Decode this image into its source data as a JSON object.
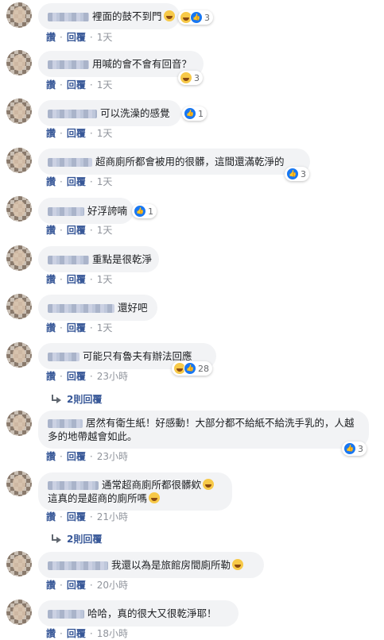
{
  "actions": {
    "like_label": "讚",
    "reply_label": "回覆",
    "dot": "·"
  },
  "comments": [
    {
      "text": "裡面的鼓不到門",
      "emoji": "grinning-squint-emoji",
      "reaction_types": [
        "haha",
        "like"
      ],
      "reaction_count": "3",
      "time": "1天"
    },
    {
      "text": "用喊的會不會有回音？",
      "reaction_types": [
        "haha"
      ],
      "reaction_count": "3",
      "time": "1天"
    },
    {
      "text": "可以洗澡的感覺",
      "reaction_types": [
        "like"
      ],
      "reaction_count": "1",
      "time": "1天"
    },
    {
      "text": "超商廁所都會被用的很髒，這間還滿乾淨的",
      "reaction_types": [
        "like"
      ],
      "reaction_count": "3",
      "time": "1天"
    },
    {
      "text": "好浮誇喃",
      "reaction_types": [
        "like"
      ],
      "reaction_count": "1",
      "time": "1天"
    },
    {
      "text": "重點是很乾淨",
      "time": "1天"
    },
    {
      "text": "還好吧",
      "time": "1天"
    },
    {
      "text": "可能只有魯夫有辦法回應",
      "reaction_types": [
        "haha",
        "like"
      ],
      "reaction_count": "28",
      "time": "23小時",
      "replies": "2則回覆"
    },
    {
      "text": "居然有衛生紙！好感動！大部分都不給紙不給洗手乳的，人越多的地帶越會如此。",
      "reaction_types": [
        "like"
      ],
      "reaction_count": "3",
      "time": "23小時"
    },
    {
      "text": "通常超商廁所都很髒欸",
      "emoji": "grinning-emoji",
      "text2": "這真的是超商的廁所嗎",
      "emoji2": "rolling-laughing-emoji",
      "time": "21小時",
      "replies": "2則回覆"
    },
    {
      "text": "我還以為是旅館房間廁所勒",
      "emoji": "rolling-laughing-emoji",
      "time": "20小時"
    },
    {
      "text": "哈哈，真的很大又很乾淨耶！",
      "time": "18小時"
    }
  ]
}
